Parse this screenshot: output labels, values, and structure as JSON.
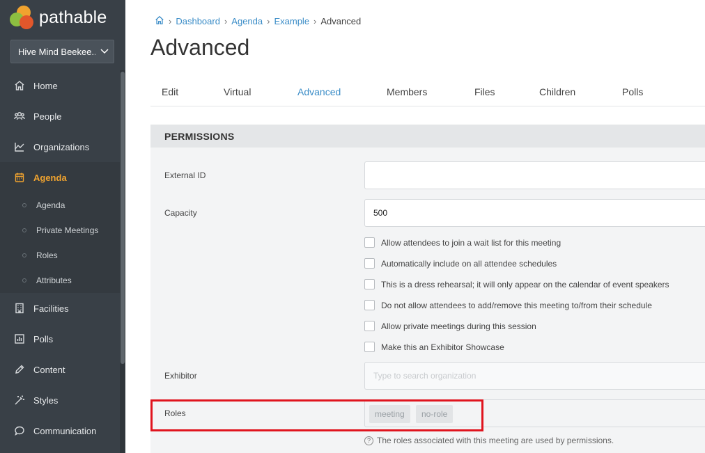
{
  "brand": {
    "name": "pathable"
  },
  "org_selector": {
    "value": "Hive Mind Beekee..."
  },
  "nav": {
    "items": [
      {
        "label": "Home",
        "icon": "home-icon"
      },
      {
        "label": "People",
        "icon": "people-icon"
      },
      {
        "label": "Organizations",
        "icon": "organizations-icon"
      },
      {
        "label": "Agenda",
        "icon": "calendar-icon",
        "active": true
      },
      {
        "label": "Facilities",
        "icon": "building-icon"
      },
      {
        "label": "Polls",
        "icon": "poll-icon"
      },
      {
        "label": "Content",
        "icon": "pencil-icon"
      },
      {
        "label": "Styles",
        "icon": "magic-wand-icon"
      },
      {
        "label": "Communication",
        "icon": "chat-icon"
      }
    ],
    "agenda_sub": [
      "Agenda",
      "Private Meetings",
      "Roles",
      "Attributes"
    ]
  },
  "breadcrumb": {
    "items": [
      "Dashboard",
      "Agenda",
      "Example"
    ],
    "current": "Advanced"
  },
  "page": {
    "title": "Advanced"
  },
  "tabs": [
    "Edit",
    "Virtual",
    "Advanced",
    "Members",
    "Files",
    "Children",
    "Polls"
  ],
  "active_tab": "Advanced",
  "permissions": {
    "header": "PERMISSIONS",
    "external_id": {
      "label": "External ID",
      "value": ""
    },
    "capacity": {
      "label": "Capacity",
      "value": "500"
    },
    "checkboxes": [
      "Allow attendees to join a wait list for this meeting",
      "Automatically include on all attendee schedules",
      "This is a dress rehearsal; it will only appear on the calendar of event speakers",
      "Do not allow attendees to add/remove this meeting to/from their schedule",
      "Allow private meetings during this session",
      "Make this an Exhibitor Showcase"
    ],
    "exhibitor": {
      "label": "Exhibitor",
      "placeholder": "Type to search organization"
    },
    "roles": {
      "label": "Roles",
      "tags": [
        "meeting",
        "no-role"
      ],
      "help": "The roles associated with this meeting are used by permissions."
    }
  },
  "colors": {
    "sidebar": "#394047",
    "accent": "#f0a32f",
    "link": "#3a8cc7",
    "highlight": "#e0141e"
  }
}
